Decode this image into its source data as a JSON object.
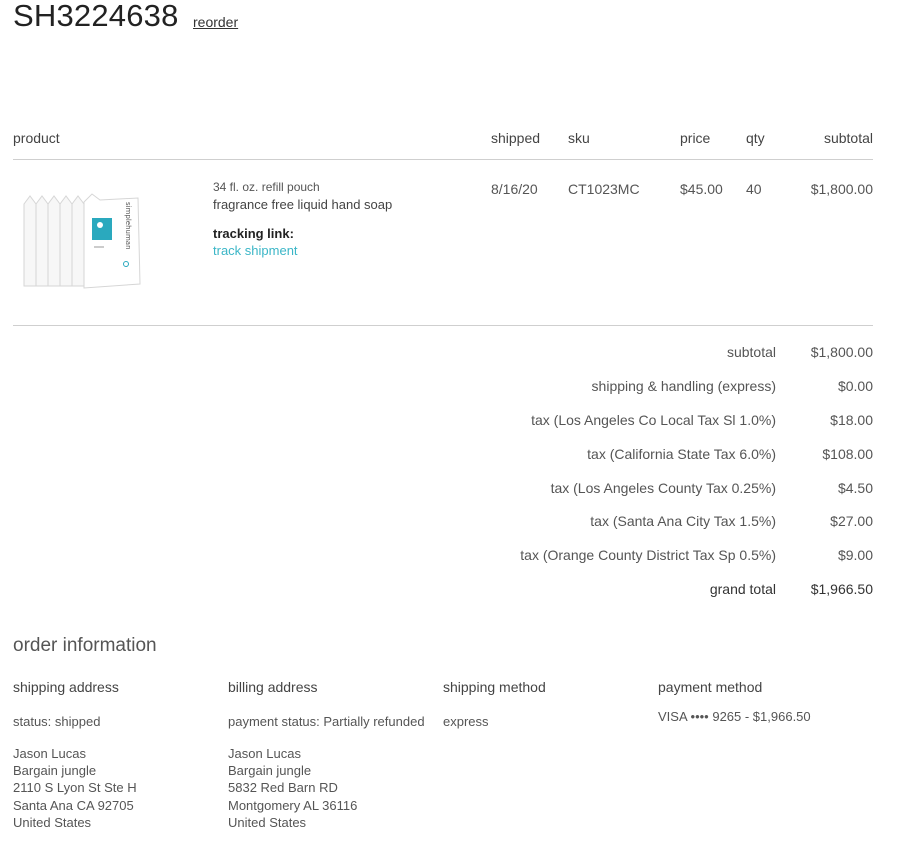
{
  "order": {
    "number": "SH3224638",
    "reorder_label": "reorder"
  },
  "table": {
    "headers": {
      "product": "product",
      "shipped": "shipped",
      "sku": "sku",
      "price": "price",
      "qty": "qty",
      "subtotal": "subtotal"
    },
    "row": {
      "variant": "34 fl. oz. refill pouch",
      "name": "fragrance free liquid hand soap",
      "tracking_label": "tracking link:",
      "tracking_link": "track shipment",
      "shipped": "8/16/20",
      "sku": "CT1023MC",
      "price": "$45.00",
      "qty": "40",
      "subtotal": "$1,800.00",
      "image_brand": "simplehuman"
    }
  },
  "totals": [
    {
      "label": "subtotal",
      "value": "$1,800.00"
    },
    {
      "label": "shipping & handling (express)",
      "value": "$0.00"
    },
    {
      "label": "tax (Los Angeles Co Local Tax Sl 1.0%)",
      "value": "$18.00"
    },
    {
      "label": "tax (California State Tax 6.0%)",
      "value": "$108.00"
    },
    {
      "label": "tax (Los Angeles County Tax 0.25%)",
      "value": "$4.50"
    },
    {
      "label": "tax (Santa Ana City Tax 1.5%)",
      "value": "$27.00"
    },
    {
      "label": "tax (Orange County District Tax Sp 0.5%)",
      "value": "$9.00"
    },
    {
      "label": "grand total",
      "value": "$1,966.50"
    }
  ],
  "order_info": {
    "title": "order information",
    "shipping_address": {
      "heading": "shipping address",
      "status": "status: shipped",
      "lines": [
        "Jason Lucas",
        "Bargain jungle",
        "2110 S Lyon St Ste H",
        "Santa Ana CA 92705",
        "United States"
      ]
    },
    "billing_address": {
      "heading": "billing address",
      "status": "payment status: Partially refunded",
      "lines": [
        "Jason Lucas",
        "Bargain jungle",
        "5832 Red Barn RD",
        "Montgomery AL 36116",
        "United States"
      ]
    },
    "shipping_method": {
      "heading": "shipping method",
      "value": "express"
    },
    "payment_method": {
      "heading": "payment method",
      "value": "VISA •••• 9265 - $1,966.50"
    }
  },
  "colors": {
    "link": "#3bb6c7",
    "rule": "#cfcfcf",
    "brand_teal": "#2aa9be"
  }
}
